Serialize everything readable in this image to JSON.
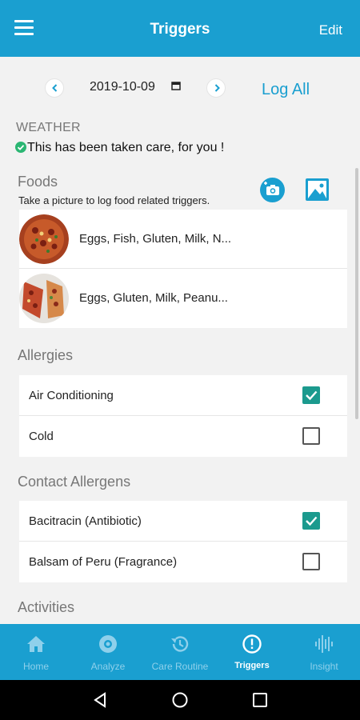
{
  "header": {
    "title": "Triggers",
    "edit_label": "Edit"
  },
  "date_bar": {
    "date": "2019-10-09",
    "log_all": "Log All"
  },
  "weather": {
    "heading": "WEATHER",
    "status": "This has been taken care, for you !"
  },
  "foods": {
    "heading": "Foods",
    "subtitle": "Take a picture to log food related triggers.",
    "items": [
      {
        "label": "Eggs, Fish, Gluten, Milk, N..."
      },
      {
        "label": "Eggs, Gluten, Milk, Peanu..."
      }
    ]
  },
  "allergies": {
    "heading": "Allergies",
    "items": [
      {
        "label": "Air Conditioning",
        "checked": true
      },
      {
        "label": "Cold",
        "checked": false
      }
    ]
  },
  "contact_allergens": {
    "heading": "Contact Allergens",
    "items": [
      {
        "label": "Bacitracin (Antibiotic)",
        "checked": true
      },
      {
        "label": "Balsam of Peru (Fragrance)",
        "checked": false
      }
    ]
  },
  "activities": {
    "heading": "Activities"
  },
  "bottom_nav": [
    {
      "label": "Home",
      "icon": "home-icon",
      "active": false
    },
    {
      "label": "Analyze",
      "icon": "analyze-icon",
      "active": false
    },
    {
      "label": "Care Routine",
      "icon": "history-icon",
      "active": false
    },
    {
      "label": "Triggers",
      "icon": "alert-icon",
      "active": true
    },
    {
      "label": "Insight",
      "icon": "waveform-icon",
      "active": false
    }
  ],
  "colors": {
    "primary": "#1a9fd0",
    "checkbox": "#1b9a8e",
    "section_header": "#777777"
  }
}
